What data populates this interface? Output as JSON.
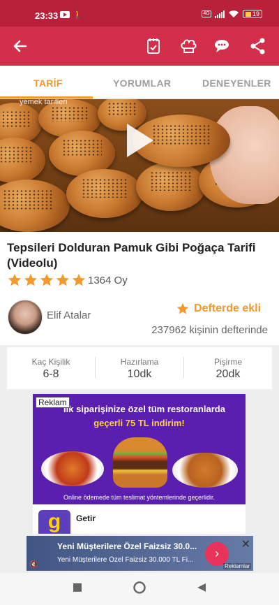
{
  "status": {
    "time": "23:33",
    "battery": "19"
  },
  "toolbar": {
    "back_icon": "arrow-left-icon",
    "icons": [
      "notebook-check-icon",
      "chef-hat-icon",
      "comment-icon",
      "share-icon"
    ]
  },
  "tabs": [
    {
      "label": "TARİF",
      "active": true
    },
    {
      "label": "YORUMLAR",
      "active": false
    },
    {
      "label": "DENEYENLER",
      "active": false
    }
  ],
  "hero": {
    "watermark": "yemek tarifleri"
  },
  "recipe": {
    "title": "Tepsileri Dolduran Pamuk Gibi Poğaça Tarifi (Videolu)",
    "rating": 5,
    "votes": "1364 Oy",
    "author": "Elif Atalar",
    "defter_label": "Defterde ekli",
    "defter_count": "237962 kişinin defterinde"
  },
  "info": [
    {
      "label": "Kaç Kişilik",
      "value": "6-8"
    },
    {
      "label": "Hazırlama",
      "value": "10dk"
    },
    {
      "label": "Pişirme",
      "value": "20dk"
    }
  ],
  "ad": {
    "label": "Reklam",
    "headline1": "İlk siparişinize özel tüm restoranlarda",
    "headline2": "geçerli 75 TL indirim!",
    "footnote": "Online ödemede tüm teslimat yöntemlerinde geçerlidir.",
    "brand_logo_char": "g",
    "brand_name": "Getir"
  },
  "banner": {
    "title": "Yeni Müşterilere Özel Faizsiz 30.0...",
    "subtitle": "Yeni Müşterilere Özel Faizsiz 30.000 TL Fi...",
    "go_icon": "chevron-right-icon",
    "reklamlar": "Reklamlar"
  },
  "colors": {
    "primary": "#d32f4a",
    "status": "#b9213a",
    "accent": "#f29a2e"
  }
}
